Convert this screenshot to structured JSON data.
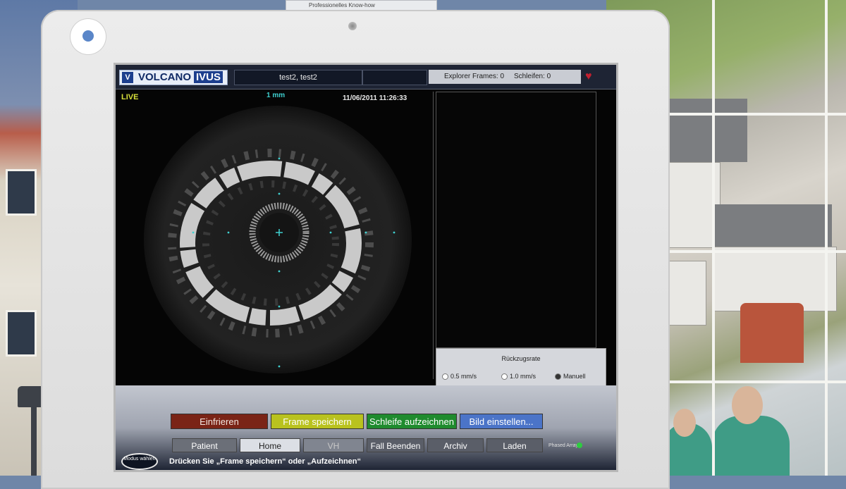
{
  "background": {
    "poster_text": "Professionelles Know-how"
  },
  "header": {
    "brand": "VOLCANO",
    "brand_suffix": "IVUS",
    "patient_name": "test2, test2",
    "explorer_frames_label": "Explorer Frames: 0",
    "loops_label": "Schleifen: 0"
  },
  "live_view": {
    "mode_label": "LIVE",
    "scale_label": "1 mm",
    "datetime": "11/06/2011 11:26:33"
  },
  "pullback": {
    "title": "Rückzugsrate",
    "options": [
      "0.5 mm/s",
      "1.0 mm/s",
      "Manuell"
    ],
    "selected": "Manuell"
  },
  "actions": {
    "freeze": "Einfrieren",
    "save_frame": "Frame speichern",
    "record_loop": "Schleife aufzeichnen",
    "image_settings": "Bild einstellen..."
  },
  "tabs": {
    "patient": "Patient",
    "home": "Home",
    "vh": "VH",
    "end_case": "Fall Beenden",
    "archive": "Archiv",
    "load": "Laden"
  },
  "status": {
    "phased_array": "Phased Array",
    "mode_button": "Modus wählen",
    "instruction": "Drücken Sie „Frame speichern“ oder „Aufzeichnen“"
  },
  "colors": {
    "freeze": "#7a2416",
    "save_frame": "#b9c21e",
    "record_loop": "#1f8b2e",
    "image_settings": "#4b74c8"
  }
}
